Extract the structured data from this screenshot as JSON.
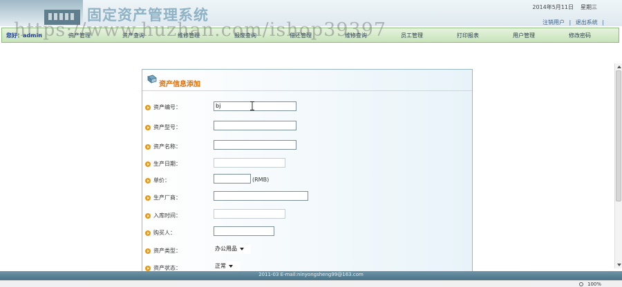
{
  "header": {
    "title": "固定资产管理系统",
    "date": "2014年5月11日",
    "weekday": "星期三",
    "links": [
      "注销用户",
      "|",
      "退出系统",
      "|"
    ]
  },
  "navbar": {
    "welcome": "您好：admin",
    "items": [
      "资产管理",
      "资产查询",
      "维修管理",
      "报废查询",
      "借还管理",
      "维修查询",
      "员工管理",
      "打印报表",
      "用户管理",
      "修改密码"
    ]
  },
  "watermark": "https://www.huzhan.com/ishop39397",
  "form": {
    "title": "资产信息添加",
    "fields": [
      {
        "label": "资产编号：",
        "value": "bj"
      },
      {
        "label": "资产型号：",
        "value": ""
      },
      {
        "label": "资产名称：",
        "value": ""
      },
      {
        "label": "生产日期：",
        "value": ""
      },
      {
        "label": "单价：",
        "value": "",
        "suffix": "(RMB)"
      },
      {
        "label": "生产厂商：",
        "value": ""
      },
      {
        "label": "入库时间：",
        "value": ""
      },
      {
        "label": "购买人：",
        "value": ""
      },
      {
        "label": "资产类型：",
        "value": "办公用品"
      },
      {
        "label": "资产状态：",
        "value": "正常"
      }
    ]
  },
  "footer": {
    "text": "2011-03 E-mail:ninyongsheng99@163.com"
  },
  "status": {
    "zoom": "100%"
  }
}
